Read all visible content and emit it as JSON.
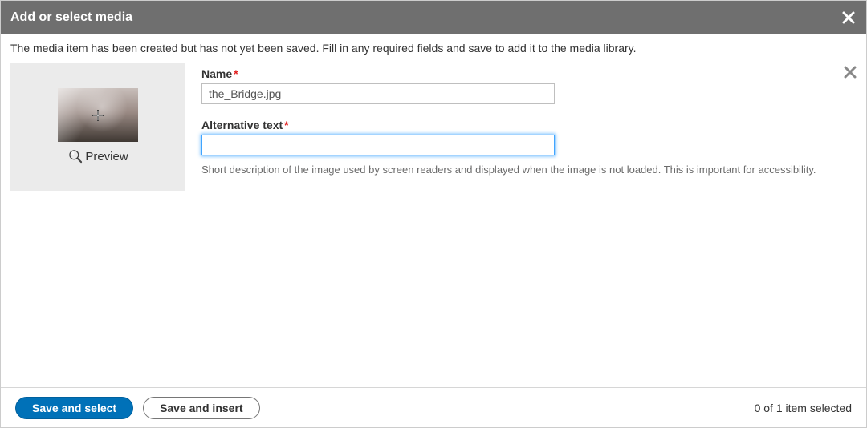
{
  "header": {
    "title": "Add or select media"
  },
  "info_text": "The media item has been created but has not yet been saved. Fill in any required fields and save to add it to the media library.",
  "thumbnail": {
    "preview_label": "Preview"
  },
  "form": {
    "name_label": "Name",
    "name_value": "the_Bridge.jpg",
    "alt_label": "Alternative text",
    "alt_value": "",
    "alt_help": "Short description of the image used by screen readers and displayed when the image is not loaded. This is important for accessibility.",
    "required_marker": "*"
  },
  "footer": {
    "save_select_label": "Save and select",
    "save_insert_label": "Save and insert",
    "selection_status": "0 of 1 item selected"
  }
}
